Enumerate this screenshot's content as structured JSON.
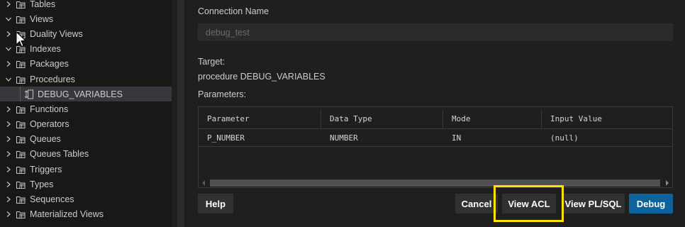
{
  "sidebar": {
    "items": [
      {
        "label": "Tables",
        "chevron": "right",
        "icon": "table-icon"
      },
      {
        "label": "Views",
        "chevron": "down",
        "icon": "view-icon"
      },
      {
        "label": "Duality Views",
        "chevron": "right",
        "icon": "duality-view-icon"
      },
      {
        "label": "Indexes",
        "chevron": "down",
        "icon": "index-icon"
      },
      {
        "label": "Packages",
        "chevron": "right",
        "icon": "package-icon"
      },
      {
        "label": "Procedures",
        "chevron": "down",
        "icon": "procedure-icon"
      },
      {
        "label": "DEBUG_VARIABLES",
        "chevron": "none",
        "icon": "procedure-item-icon",
        "selected": true,
        "child": true
      },
      {
        "label": "Functions",
        "chevron": "right",
        "icon": "function-icon"
      },
      {
        "label": "Operators",
        "chevron": "right",
        "icon": "operator-icon"
      },
      {
        "label": "Queues",
        "chevron": "right",
        "icon": "queue-icon"
      },
      {
        "label": "Queues Tables",
        "chevron": "right",
        "icon": "queue-table-icon"
      },
      {
        "label": "Triggers",
        "chevron": "right",
        "icon": "trigger-icon"
      },
      {
        "label": "Types",
        "chevron": "right",
        "icon": "type-icon"
      },
      {
        "label": "Sequences",
        "chevron": "right",
        "icon": "sequence-icon"
      },
      {
        "label": "Materialized Views",
        "chevron": "right",
        "icon": "materialized-view-icon"
      }
    ]
  },
  "dialog": {
    "connection_label": "Connection Name",
    "connection_value": "debug_test",
    "target_label": "Target:",
    "target_value": "procedure DEBUG_VARIABLES",
    "parameters_label": "Parameters:",
    "table": {
      "headers": [
        "Parameter",
        "Data Type",
        "Mode",
        "Input Value"
      ],
      "rows": [
        [
          "P_NUMBER",
          "NUMBER",
          "IN",
          "(null)"
        ]
      ]
    },
    "buttons": {
      "help": "Help",
      "cancel": "Cancel",
      "view_acl": "View ACL",
      "view_plsql": "View PL/SQL",
      "debug": "Debug"
    }
  },
  "colors": {
    "accent": "#0e639c",
    "highlight": "#ffe100",
    "selected_row": "#37373d"
  }
}
